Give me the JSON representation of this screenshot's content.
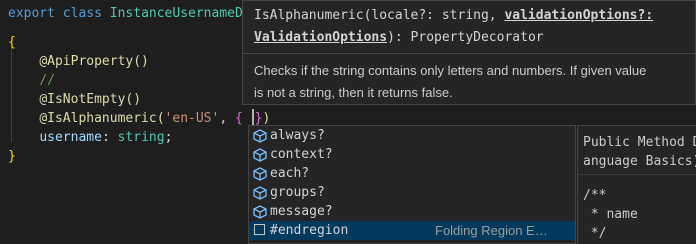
{
  "code": {
    "line1": {
      "kw_export": "export",
      "kw_class": "class",
      "class_name": "InstanceUsernameDt"
    },
    "line2": {
      "open_brace": "{"
    },
    "line3": {
      "decorator": "@ApiProperty()"
    },
    "line4": {
      "comment": "//"
    },
    "line5": {
      "decorator": "@IsNotEmpty()"
    },
    "line6": {
      "decorator": "@IsAlphanumeric(",
      "arg": "'en-US'",
      "comma": ",",
      "brace_open": "{",
      "brace_close": "}",
      "close": ")"
    },
    "line7": {
      "prop": "username",
      "colon": ":",
      "type": "string",
      "semi": ";"
    },
    "line8": {
      "close_brace": "}"
    }
  },
  "hover": {
    "sig_prefix": "IsAlphanumeric(locale?: string, ",
    "sig_param": "validationOptions?:",
    "sig_type": "ValidationOptions",
    "sig_suffix": "): PropertyDecorator",
    "doc_line1": "Checks if the string contains only letters and numbers. If given value",
    "doc_line2": "is not a string, then it returns false."
  },
  "suggest": {
    "items": [
      {
        "label": "always?",
        "icon": "property-icon"
      },
      {
        "label": "context?",
        "icon": "property-icon"
      },
      {
        "label": "each?",
        "icon": "property-icon"
      },
      {
        "label": "groups?",
        "icon": "property-icon"
      },
      {
        "label": "message?",
        "icon": "property-icon"
      },
      {
        "label": "#endregion",
        "icon": "snippet-icon",
        "detail": "Folding Region E…"
      }
    ]
  },
  "details": {
    "line1": "Public Method D",
    "line2": "anguage Basics)",
    "line3": "/**",
    "line4": " * name",
    "line5": " */"
  },
  "colors": {
    "background": "#1e1e1e",
    "widget": "#252526",
    "selection": "#04395e",
    "keyword": "#569cd6",
    "class": "#4ec9b0",
    "function": "#dcdcaa",
    "string": "#ce9178",
    "comment": "#6a9955",
    "property": "#9cdcfe",
    "icon": "#75beff"
  }
}
